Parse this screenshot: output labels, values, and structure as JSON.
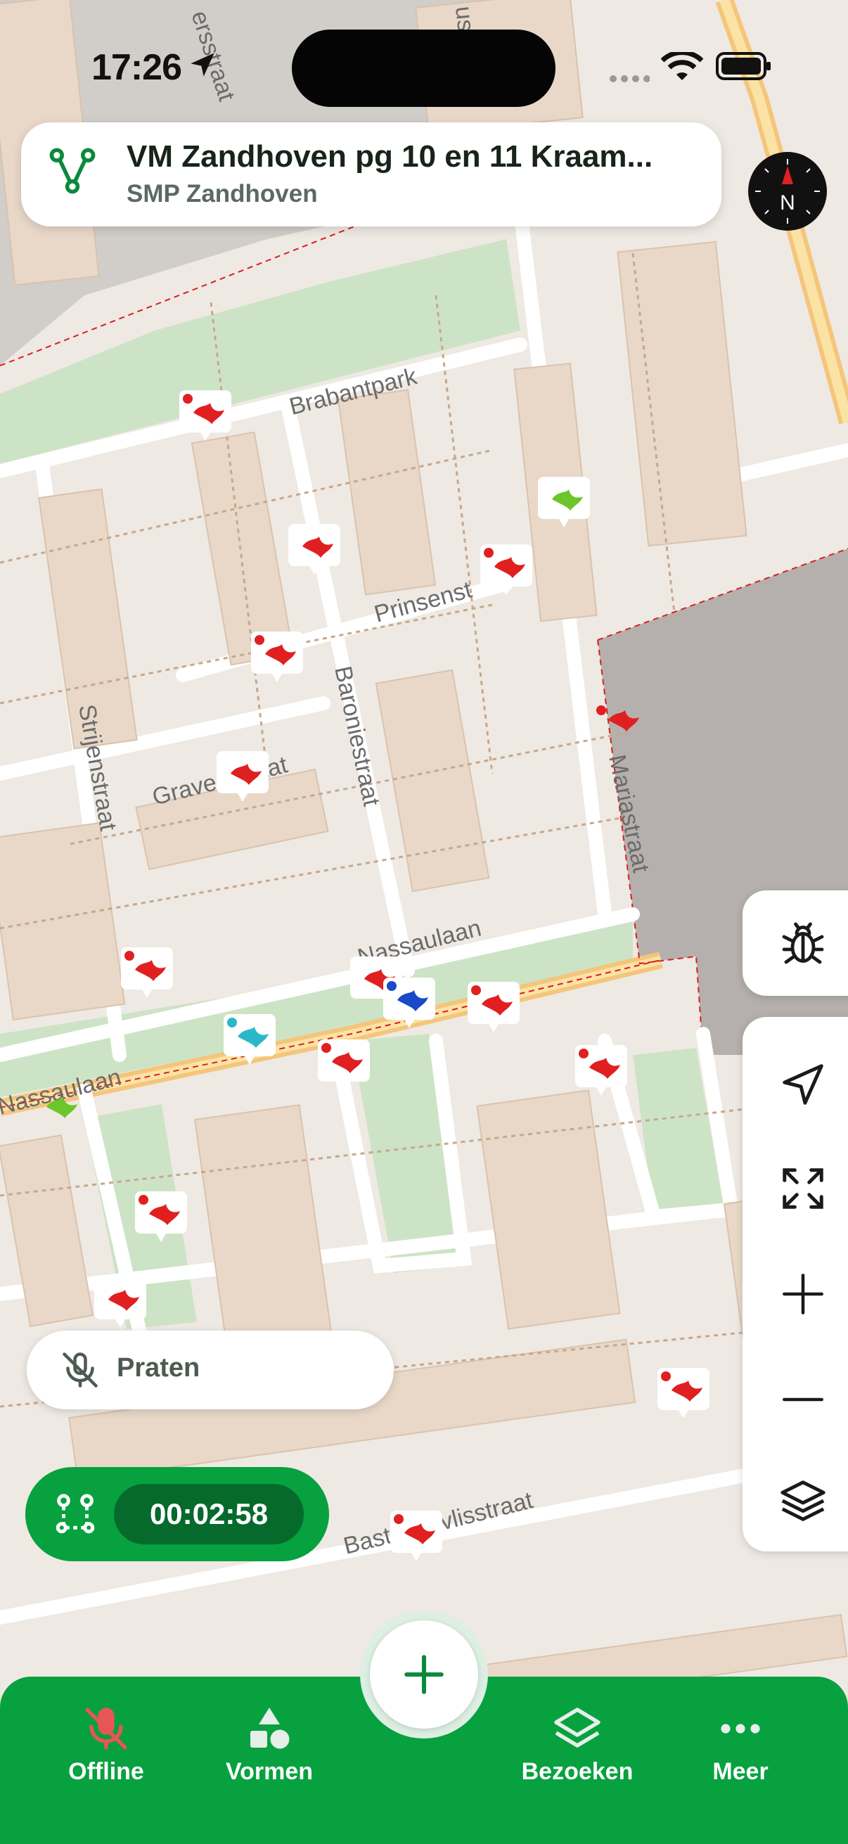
{
  "status_bar": {
    "time": "17:26",
    "location_icon": "location-arrow-icon",
    "wifi_icon": "wifi-icon",
    "battery_icon": "battery-icon"
  },
  "project": {
    "title": "VM Zandhoven pg 10 en 11 Kraam...",
    "subtitle": "SMP Zandhoven",
    "icon": "route-icon",
    "accent": "#0a8a3c"
  },
  "compass": {
    "icon": "compass-icon",
    "label": "N"
  },
  "map": {
    "street_labels": [
      "Brabantpark",
      "Prinsenst",
      "Strijenstraat",
      "Gravenstraat",
      "Baroniestraat",
      "Nassaulaan",
      "Mariastraat",
      "Nassaulaan",
      "Bastoonsvlisstraat",
      "ersstraat",
      "usstr"
    ],
    "marker_colors": {
      "red": "#e02020",
      "green": "#6cc52a",
      "blue": "#1a49c9",
      "cyan": "#2ab8c9"
    }
  },
  "side_controls": {
    "bug": "bug-icon",
    "locate": "navigate-arrow-icon",
    "fit": "expand-icon",
    "zoom_in": "plus-icon",
    "zoom_out": "minus-icon",
    "layers": "layers-icon"
  },
  "talk": {
    "label": "Praten",
    "icon": "mic-off-icon"
  },
  "timer": {
    "value": "00:02:58",
    "icon": "route-points-icon"
  },
  "bottom_nav": {
    "items": [
      {
        "label": "Offline",
        "icon": "mic-off-icon"
      },
      {
        "label": "Vormen",
        "icon": "shapes-icon"
      },
      {
        "label": "Bezoeken",
        "icon": "layers-icon"
      },
      {
        "label": "Meer",
        "icon": "more-icon"
      }
    ],
    "fab_icon": "plus-icon",
    "color": "#07a13f"
  }
}
